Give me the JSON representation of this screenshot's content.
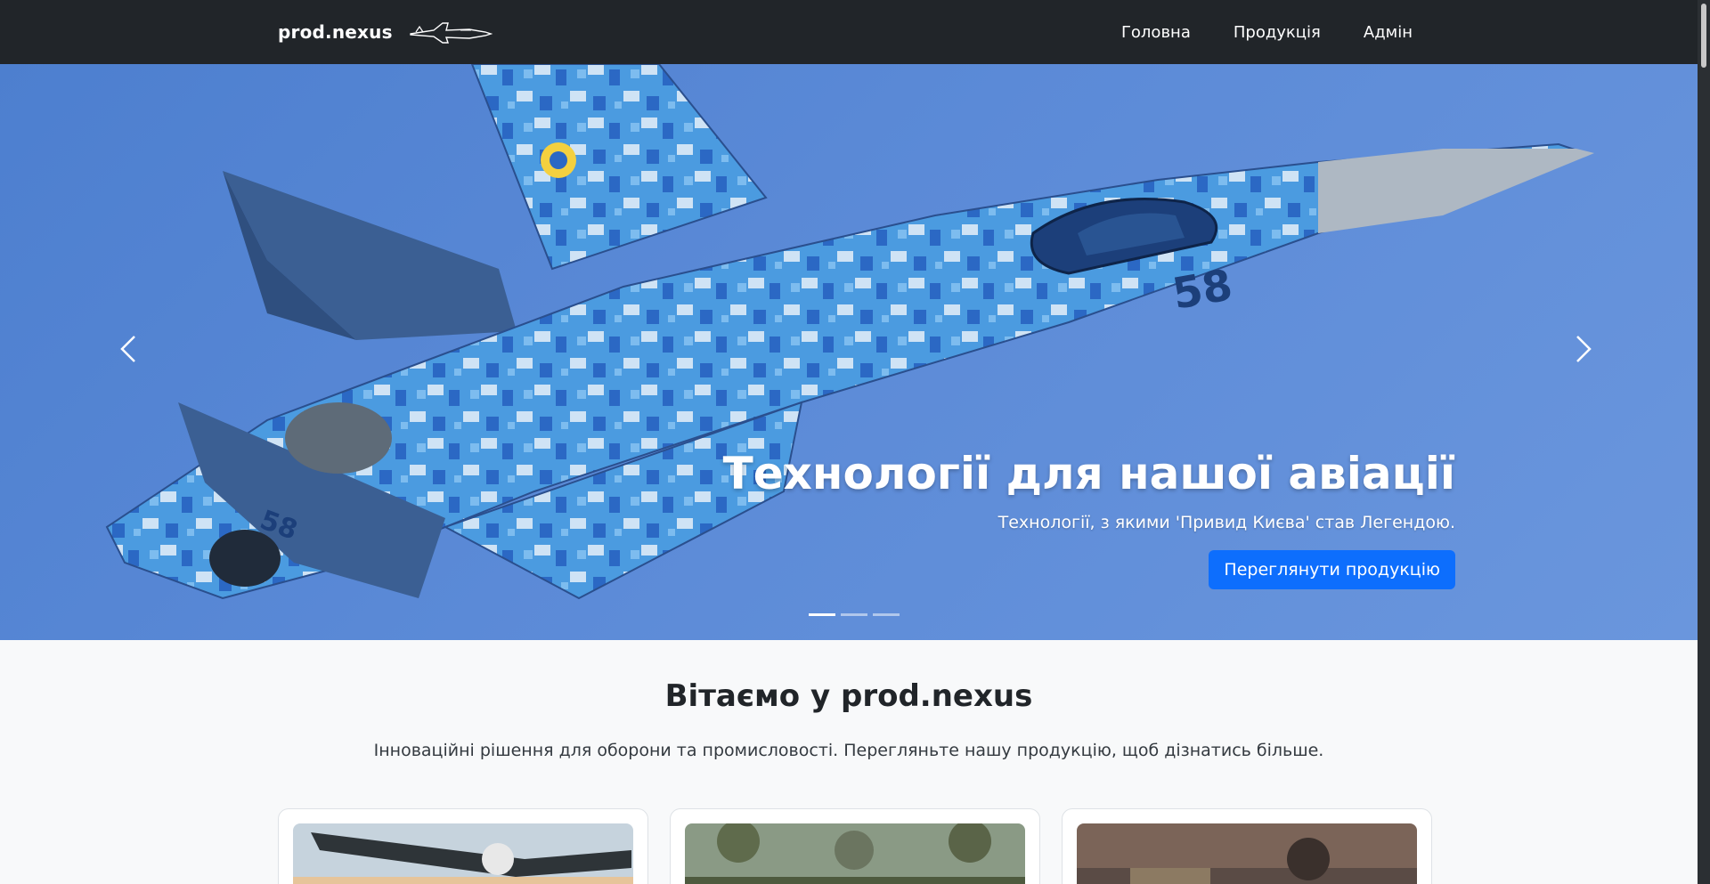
{
  "navbar": {
    "brand": "prod.nexus",
    "brand_logo_icon": "fighter-jet-icon",
    "links": [
      "Головна",
      "Продукція",
      "Адмін"
    ]
  },
  "hero": {
    "image": "fighter-jet-digital-camo-photo",
    "title": "Технології для нашої авіації",
    "subtitle": "Технології, з якими 'Привид Києва' став Легендою.",
    "button": "Переглянути продукцію",
    "prev_icon": "chevron-left-icon",
    "next_icon": "chevron-right-icon",
    "slides_count": 3,
    "active_slide": 1
  },
  "welcome": {
    "title": "Вітаємо у prod.nexus",
    "text": "Інноваційні рішення для оборони та промисловості. Перегляньте нашу продукцію, щоб дізнатись більше."
  },
  "cards": [
    {
      "image": "drone-photo"
    },
    {
      "image": "soldiers-group-photo"
    },
    {
      "image": "soldier-sunset-photo"
    }
  ],
  "colors": {
    "navbar_bg": "#212529",
    "primary": "#0d6efd",
    "page_bg": "#f8f9fa"
  }
}
